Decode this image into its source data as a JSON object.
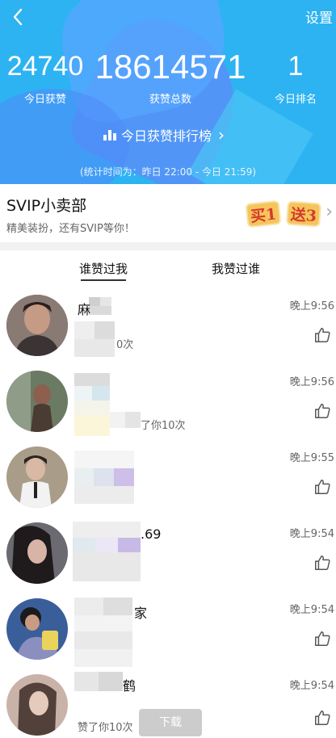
{
  "header": {
    "settings_label": "设置",
    "today_likes": {
      "value": "24740",
      "label": "今日获赞"
    },
    "total_likes": {
      "value": "18614571",
      "label": "获赞总数"
    },
    "today_rank": {
      "value": "1",
      "label": "今日排名"
    },
    "leaderboard_label": "今日获赞排行榜",
    "period": "(统计时间为：昨日 22:00 - 今日 21:59)"
  },
  "svip": {
    "title": "SVIP小卖部",
    "subtitle": "精美装扮，还有SVIP等你！",
    "badge_buy": "买1",
    "badge_gift": "送3"
  },
  "tabs": [
    {
      "label": "谁赞过我"
    },
    {
      "label": "我赞过谁"
    }
  ],
  "list": [
    {
      "name": "麻",
      "likes": "0次",
      "time": "晚上9:56"
    },
    {
      "name": "",
      "likes": "了你10次",
      "time": "晚上9:56"
    },
    {
      "name": "",
      "likes": "",
      "time": "晚上9:55"
    },
    {
      "name": ".69",
      "likes": "",
      "time": "晚上9:54"
    },
    {
      "name": "家",
      "likes": "",
      "time": "晚上9:54"
    },
    {
      "name": "鹤",
      "likes": "赞了你10次",
      "time": "晚上9:54"
    }
  ],
  "download_label": "下载",
  "colors": {
    "header_bg": "#2db3f2",
    "accent_text": "#ffffff"
  }
}
